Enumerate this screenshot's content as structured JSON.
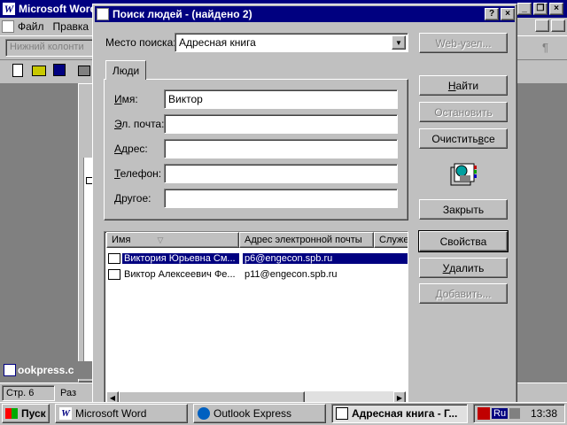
{
  "word": {
    "title": "Microsoft Word",
    "menu": [
      "Файл",
      "Правка"
    ],
    "style_box": "Нижний колонти",
    "status_page": "Стр. 6",
    "status_section": "Раз",
    "doc_tab": "ookpress.c",
    "right_glyph": "¶"
  },
  "dialog": {
    "title": "Поиск людей - (найдено 2)",
    "search_in_label": "Место поиска:",
    "search_in_value": "Адресная книга",
    "web_button": "Web-узел...",
    "tab_people": "Люди",
    "fields": {
      "name_label": "Имя:",
      "name_value": "Виктор",
      "email_label": "Эл. почта:",
      "email_value": "",
      "address_label": "Адрес:",
      "address_value": "",
      "phone_label": "Телефон:",
      "phone_value": "",
      "other_label": "Другое:",
      "other_value": ""
    },
    "buttons": {
      "find": "Найти",
      "stop": "Остановить",
      "clear": "Очистить все",
      "close": "Закрыть",
      "properties": "Свойства",
      "delete": "Удалить",
      "add": "Добавить..."
    },
    "columns": [
      "Имя",
      "Адрес электронной почты",
      "Служе"
    ],
    "results": [
      {
        "name": "Виктория Юрьевна См...",
        "email": "p6@engecon.spb.ru",
        "selected": true
      },
      {
        "name": "Виктор Алексеевич Фе...",
        "email": "p11@engecon.spb.ru",
        "selected": false
      }
    ]
  },
  "taskbar": {
    "start": "Пуск",
    "items": [
      "Microsoft Word",
      "Outlook Express",
      "Адресная книга - Г..."
    ],
    "lang": "Ru",
    "time": "13:38"
  },
  "colors": {
    "title_active": "#000080",
    "face": "#c0c0c0",
    "desktop": "#808080",
    "selection": "#000080"
  }
}
